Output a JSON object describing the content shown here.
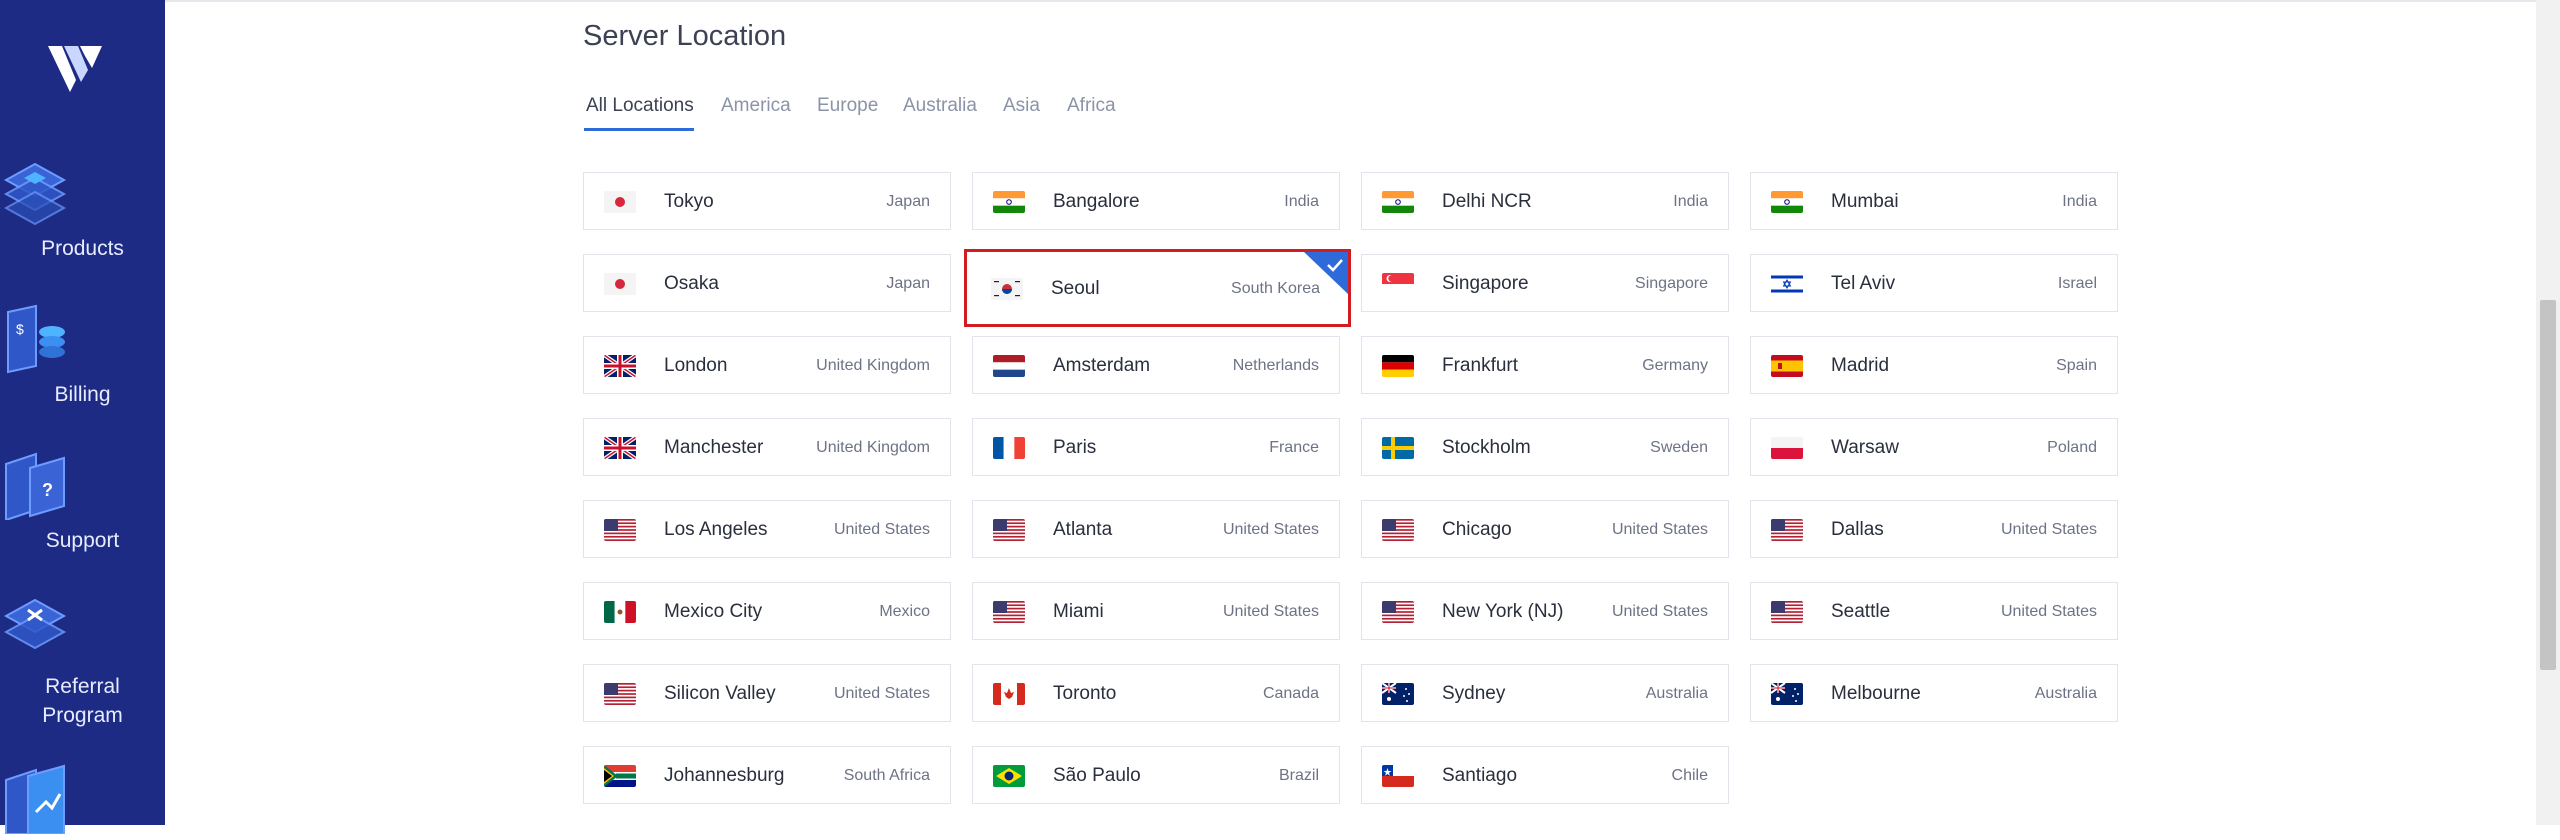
{
  "sidebar": {
    "items": [
      {
        "label": "Products",
        "icon": "products-icon"
      },
      {
        "label": "Billing",
        "icon": "billing-icon"
      },
      {
        "label": "Support",
        "icon": "support-icon"
      },
      {
        "label": "Referral",
        "label2": "Program",
        "icon": "referral-icon"
      }
    ]
  },
  "page": {
    "title": "Server Location"
  },
  "tabs": [
    "All Locations",
    "America",
    "Europe",
    "Australia",
    "Asia",
    "Africa"
  ],
  "active_tab": "All Locations",
  "selected_location": "Seoul",
  "locations": [
    {
      "city": "Tokyo",
      "country": "Japan",
      "flag": "jp"
    },
    {
      "city": "Bangalore",
      "country": "India",
      "flag": "in"
    },
    {
      "city": "Delhi NCR",
      "country": "India",
      "flag": "in"
    },
    {
      "city": "Mumbai",
      "country": "India",
      "flag": "in"
    },
    {
      "city": "Osaka",
      "country": "Japan",
      "flag": "jp"
    },
    {
      "city": "Seoul",
      "country": "South Korea",
      "flag": "kr"
    },
    {
      "city": "Singapore",
      "country": "Singapore",
      "flag": "sg"
    },
    {
      "city": "Tel Aviv",
      "country": "Israel",
      "flag": "il"
    },
    {
      "city": "London",
      "country": "United Kingdom",
      "flag": "gb"
    },
    {
      "city": "Amsterdam",
      "country": "Netherlands",
      "flag": "nl"
    },
    {
      "city": "Frankfurt",
      "country": "Germany",
      "flag": "de"
    },
    {
      "city": "Madrid",
      "country": "Spain",
      "flag": "es"
    },
    {
      "city": "Manchester",
      "country": "United Kingdom",
      "flag": "gb"
    },
    {
      "city": "Paris",
      "country": "France",
      "flag": "fr"
    },
    {
      "city": "Stockholm",
      "country": "Sweden",
      "flag": "se"
    },
    {
      "city": "Warsaw",
      "country": "Poland",
      "flag": "pl"
    },
    {
      "city": "Los Angeles",
      "country": "United States",
      "flag": "us"
    },
    {
      "city": "Atlanta",
      "country": "United States",
      "flag": "us"
    },
    {
      "city": "Chicago",
      "country": "United States",
      "flag": "us"
    },
    {
      "city": "Dallas",
      "country": "United States",
      "flag": "us"
    },
    {
      "city": "Mexico City",
      "country": "Mexico",
      "flag": "mx"
    },
    {
      "city": "Miami",
      "country": "United States",
      "flag": "us"
    },
    {
      "city": "New York (NJ)",
      "country": "United States",
      "flag": "us"
    },
    {
      "city": "Seattle",
      "country": "United States",
      "flag": "us"
    },
    {
      "city": "Silicon Valley",
      "country": "United States",
      "flag": "us"
    },
    {
      "city": "Toronto",
      "country": "Canada",
      "flag": "ca"
    },
    {
      "city": "Sydney",
      "country": "Australia",
      "flag": "au"
    },
    {
      "city": "Melbourne",
      "country": "Australia",
      "flag": "au"
    },
    {
      "city": "Johannesburg",
      "country": "South Africa",
      "flag": "za"
    },
    {
      "city": "São Paulo",
      "country": "Brazil",
      "flag": "br"
    },
    {
      "city": "Santiago",
      "country": "Chile",
      "flag": "cl"
    }
  ],
  "colors": {
    "sidebar": "#1e2b85",
    "accent": "#2f6bd8",
    "selected_border": "#d11c22"
  }
}
